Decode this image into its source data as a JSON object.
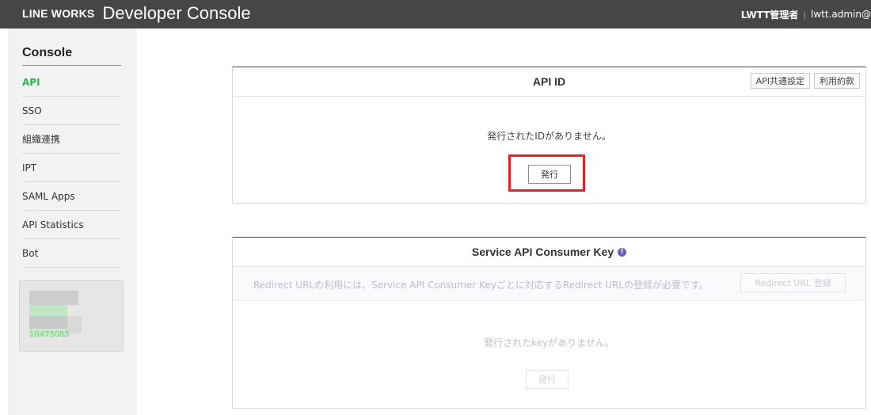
{
  "header": {
    "logo": "LINE WORKS",
    "title": "Developer Console",
    "account_name": "LWTT管理者",
    "separator": "|",
    "account_id": "lwtt.admin@"
  },
  "sidebar": {
    "title": "Console",
    "items": [
      {
        "label": "API",
        "active": true
      },
      {
        "label": "SSO"
      },
      {
        "label": "組織連携"
      },
      {
        "label": "IPT"
      },
      {
        "label": "SAML Apps"
      },
      {
        "label": "API Statistics"
      },
      {
        "label": "Bot"
      }
    ],
    "profile_id_partial": "10475085"
  },
  "api_id_panel": {
    "title": "API ID",
    "common_settings_label": "API共通設定",
    "terms_label": "利用約款",
    "empty_message": "発行されたIDがありません。",
    "issue_button": "発行"
  },
  "consumer_key_panel": {
    "title": "Service API Consumer Key",
    "info_icon": "!",
    "notice": "Redirect URLの利用には、Service API Consumer Keyごとに対応するRedirect URLの登録が必要です。",
    "redirect_button": "Redirect URL 登録",
    "empty_message": "発行されたkeyがありません。",
    "issue_button": "発行"
  },
  "colors": {
    "header_bg": "#464646",
    "active_nav": "#2bb54b",
    "highlight": "#ee1c25",
    "info_icon": "#6a5fb0"
  }
}
